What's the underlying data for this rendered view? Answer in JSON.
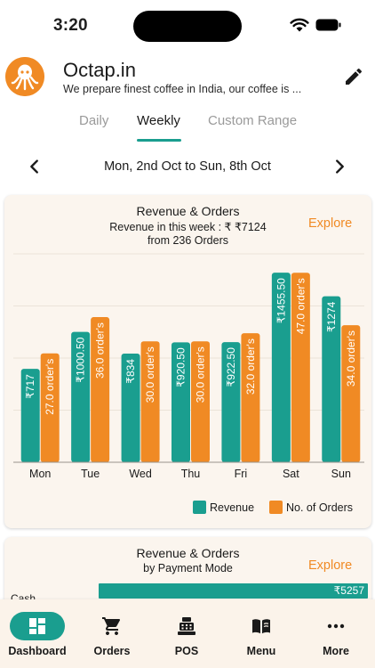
{
  "status_bar": {
    "time": "3:20"
  },
  "header": {
    "store_name": "Octap.in",
    "store_description": "We prepare finest coffee in India, our coffee is ...",
    "edit_icon": "pencil-icon"
  },
  "tabs": [
    {
      "label": "Daily",
      "selected": false
    },
    {
      "label": "Weekly",
      "selected": true
    },
    {
      "label": "Custom Range",
      "selected": false
    }
  ],
  "date_range": {
    "label": "Mon, 2nd Oct to Sun, 8th Oct"
  },
  "colors": {
    "revenue": "#1a9e8f",
    "orders": "#f08a24",
    "card_bg": "#fbf5ee"
  },
  "revenue_card": {
    "title": "Revenue & Orders",
    "subtitle_line1": "Revenue in this week : ₹ ₹7124",
    "subtitle_line2": "from 236 Orders",
    "explore_label": "Explore",
    "legend": [
      {
        "label": "Revenue"
      },
      {
        "label": "No. of Orders"
      }
    ]
  },
  "chart_data": {
    "type": "bar",
    "title": "Revenue & Orders",
    "categories": [
      "Mon",
      "Tue",
      "Wed",
      "Thu",
      "Fri",
      "Sat",
      "Sun"
    ],
    "series": [
      {
        "name": "Revenue",
        "values": [
          717,
          1000.5,
          834,
          920.5,
          922.5,
          1455.5,
          1274
        ],
        "labels": [
          "₹717",
          "₹1000.50",
          "₹834",
          "₹920.50",
          "₹922.50",
          "₹1455.50",
          "₹1274"
        ]
      },
      {
        "name": "No. of Orders",
        "values": [
          27,
          36,
          30,
          30,
          32,
          47,
          34
        ],
        "labels": [
          "27.0 order's",
          "36.0 order's",
          "30.0 order's",
          "30.0 order's",
          "32.0 order's",
          "47.0 order's",
          "34.0 order's"
        ]
      }
    ],
    "grid": true,
    "legend_position": "bottom-right"
  },
  "payment_card": {
    "title": "Revenue & Orders",
    "subtitle": "by Payment Mode",
    "explore_label": "Explore",
    "rows": [
      {
        "mode": "Cash",
        "value_label": "₹5257",
        "value": 5257
      }
    ]
  },
  "bottom_nav": [
    {
      "label": "Dashboard",
      "icon": "dashboard-icon",
      "active": true
    },
    {
      "label": "Orders",
      "icon": "cart-icon",
      "active": false
    },
    {
      "label": "POS",
      "icon": "cash-register-icon",
      "active": false
    },
    {
      "label": "Menu",
      "icon": "book-icon",
      "active": false
    },
    {
      "label": "More",
      "icon": "more-dots-icon",
      "active": false
    }
  ]
}
